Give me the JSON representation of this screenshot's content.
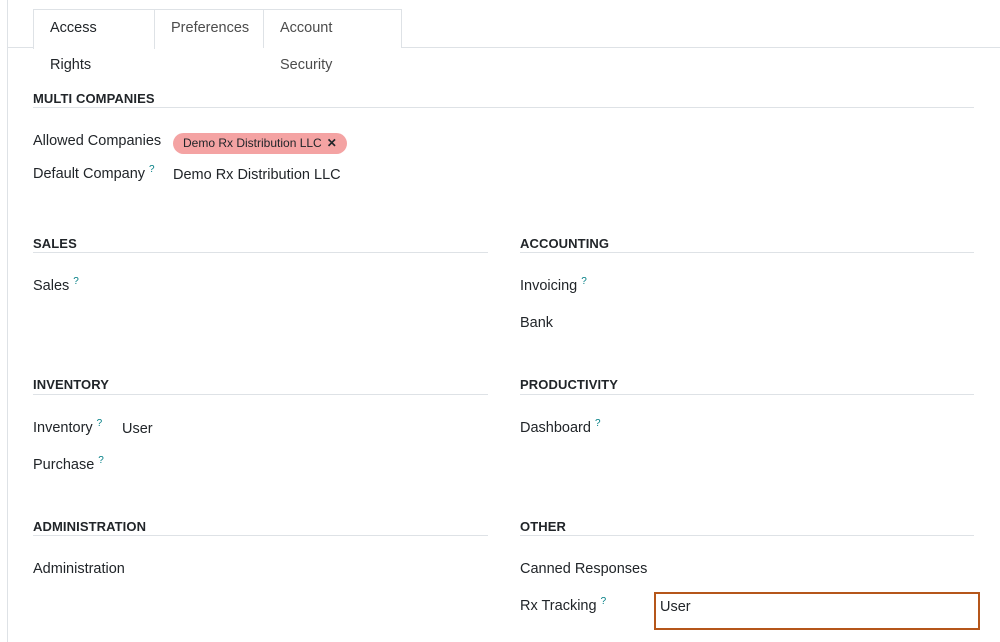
{
  "tabs": [
    "Access Rights",
    "Preferences",
    "Account Security"
  ],
  "multi_companies": {
    "title": "MULTI COMPANIES",
    "allowed_label": "Allowed Companies",
    "allowed_tag": "Demo Rx Distribution LLC",
    "tag_remove": "✕",
    "default_label": "Default Company",
    "default_value": "Demo Rx Distribution LLC"
  },
  "sales": {
    "title": "SALES",
    "sales_label": "Sales"
  },
  "accounting": {
    "title": "ACCOUNTING",
    "invoicing_label": "Invoicing",
    "bank_label": "Bank"
  },
  "inventory": {
    "title": "INVENTORY",
    "inventory_label": "Inventory",
    "inventory_value": "User",
    "purchase_label": "Purchase"
  },
  "productivity": {
    "title": "PRODUCTIVITY",
    "dashboard_label": "Dashboard"
  },
  "administration": {
    "title": "ADMINISTRATION",
    "administration_label": "Administration"
  },
  "other": {
    "title": "OTHER",
    "canned_label": "Canned Responses",
    "rx_label": "Rx Tracking",
    "rx_value": "User"
  },
  "help_mark": "?",
  "colors": {
    "tag_bg": "#f4a3a3",
    "help": "#017e84",
    "focus_border": "#b5561a"
  }
}
